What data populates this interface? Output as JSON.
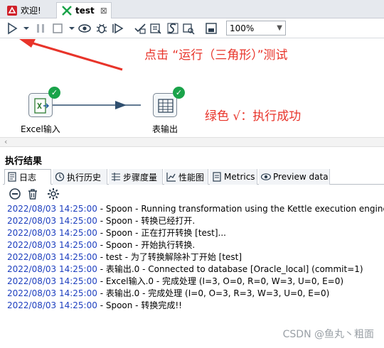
{
  "tabs": [
    {
      "label": "欢迎!",
      "icon": "welcome-icon"
    },
    {
      "label": "test",
      "icon": "transformation-icon",
      "active": true
    }
  ],
  "toolbar": {
    "icons": [
      "run-icon",
      "run-dropdown-icon",
      "pause-icon",
      "stop-icon",
      "stop-dropdown-icon",
      "preview-icon",
      "debug-icon",
      "replay-icon",
      "verify-icon",
      "analyze-impact-icon",
      "sql-icon",
      "explore-db-icon",
      "show-results-icon"
    ],
    "zoom_value": "100%"
  },
  "canvas": {
    "annotation_run": "点击 “运行（三角形）”测试",
    "annotation_success": "绿色 √：执行成功",
    "steps": [
      {
        "label": "Excel输入",
        "icon": "excel-input-icon",
        "status": "✓"
      },
      {
        "label": "表输出",
        "icon": "table-output-icon",
        "status": "✓"
      }
    ]
  },
  "results": {
    "title": "执行结果",
    "tabs": [
      {
        "label": "日志",
        "icon": "log-icon",
        "active": true
      },
      {
        "label": "执行历史",
        "icon": "history-icon"
      },
      {
        "label": "步骤度量",
        "icon": "step-metrics-icon"
      },
      {
        "label": "性能图",
        "icon": "performance-icon"
      },
      {
        "label": "Metrics",
        "icon": "metrics-icon"
      },
      {
        "label": "Preview data",
        "icon": "preview-data-icon"
      }
    ],
    "log_tools": [
      "stop-log-icon",
      "clear-log-icon",
      "log-settings-icon"
    ],
    "log_lines": [
      {
        "ts": "2022/08/03 14:25:00",
        "text": " - Spoon - Running transformation using the Kettle execution engine"
      },
      {
        "ts": "2022/08/03 14:25:00",
        "text": " - Spoon - 转换已经打开."
      },
      {
        "ts": "2022/08/03 14:25:00",
        "text": " - Spoon - 正在打开转换 [test]..."
      },
      {
        "ts": "2022/08/03 14:25:00",
        "text": " - Spoon - 开始执行转换."
      },
      {
        "ts": "2022/08/03 14:25:00",
        "text": " - test - 为了转换解除补丁开始  [test]"
      },
      {
        "ts": "2022/08/03 14:25:00",
        "text": " - 表输出.0 - Connected to database [Oracle_local] (commit=1)"
      },
      {
        "ts": "2022/08/03 14:25:00",
        "text": " - Excel输入.0 - 完成处理 (I=3, O=0, R=0, W=3, U=0, E=0)"
      },
      {
        "ts": "2022/08/03 14:25:00",
        "text": " - 表输出.0 - 完成处理 (I=0, O=3, R=3, W=3, U=0, E=0)"
      },
      {
        "ts": "2022/08/03 14:25:00",
        "text": " - Spoon - 转换完成!!"
      }
    ]
  },
  "watermark": "CSDN @鱼丸丶粗面",
  "colors": {
    "annotation": "#e8342a",
    "success": "#1aa34a",
    "timestamp": "#1d3fbf",
    "hop": "#2f4f6f"
  }
}
